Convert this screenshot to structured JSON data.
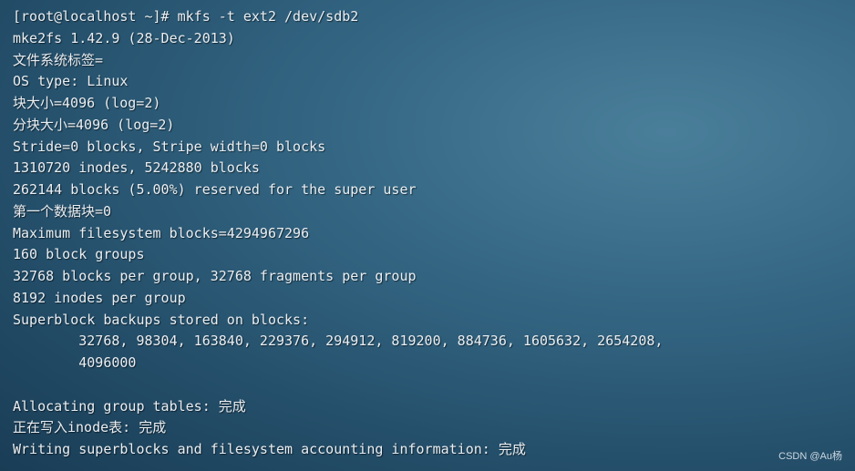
{
  "terminal": {
    "lines": [
      "[root@localhost ~]# mkfs -t ext2 /dev/sdb2",
      "mke2fs 1.42.9 (28-Dec-2013)",
      "文件系统标签=",
      "OS type: Linux",
      "块大小=4096 (log=2)",
      "分块大小=4096 (log=2)",
      "Stride=0 blocks, Stripe width=0 blocks",
      "1310720 inodes, 5242880 blocks",
      "262144 blocks (5.00%) reserved for the super user",
      "第一个数据块=0",
      "Maximum filesystem blocks=4294967296",
      "160 block groups",
      "32768 blocks per group, 32768 fragments per group",
      "8192 inodes per group",
      "Superblock backups stored on blocks:",
      "        32768, 98304, 163840, 229376, 294912, 819200, 884736, 1605632, 2654208,",
      "        4096000",
      "",
      "Allocating group tables: 完成",
      "正在写入inode表: 完成",
      "Writing superblocks and filesystem accounting information: 完成"
    ]
  },
  "watermark": {
    "text": "CSDN @Au杨"
  },
  "colors": {
    "text": "#e9eef2",
    "background": "#2b5a76"
  }
}
